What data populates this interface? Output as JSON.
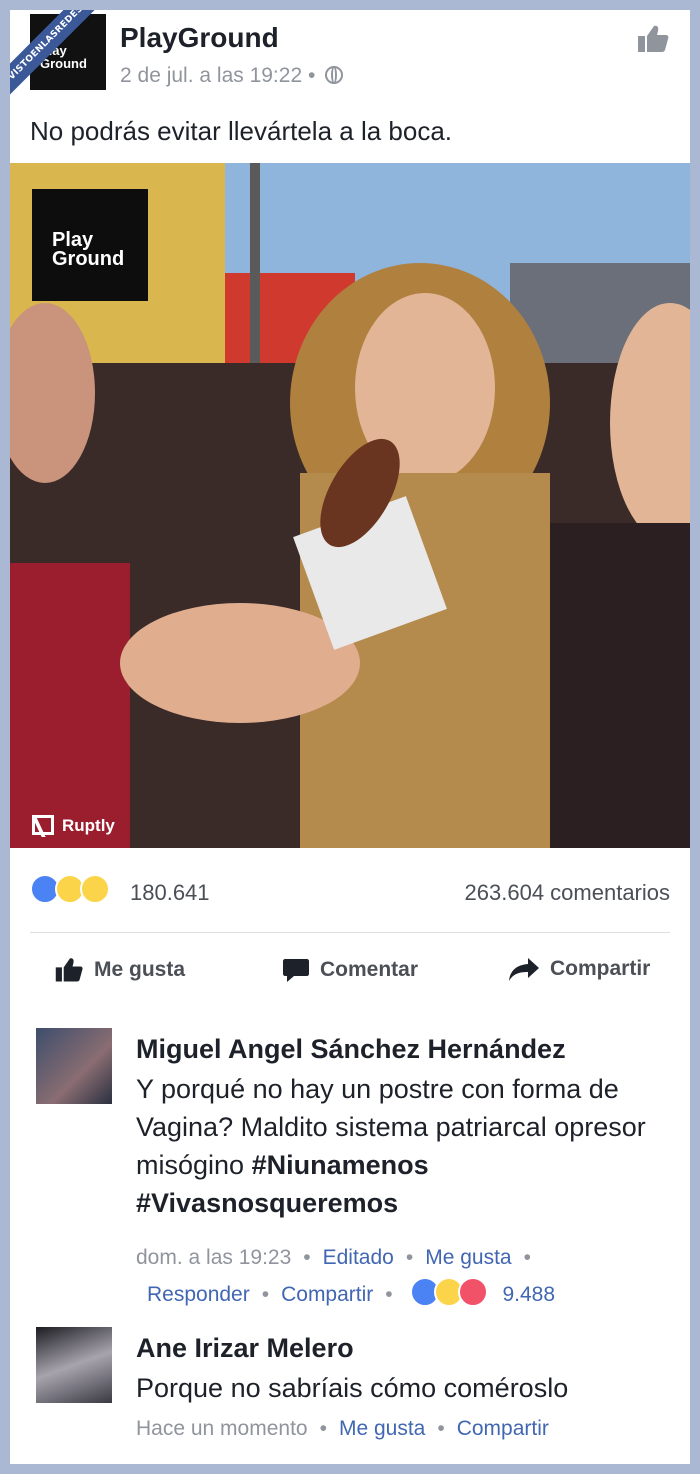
{
  "ribbon": "VISTOENLASREDES",
  "header": {
    "logo_text": "Play Ground",
    "page_name": "PlayGround",
    "post_time": "2 de jul. a las 19:22",
    "separator": "•"
  },
  "post": {
    "caption": "No podrás evitar llevártela a la boca.",
    "video_logo": "Play Ground",
    "video_source": "Ruptly"
  },
  "stats": {
    "reactions_count": "180.641",
    "comments_count": "263.604 comentarios"
  },
  "actions": {
    "like": "Me gusta",
    "comment": "Comentar",
    "share": "Compartir"
  },
  "comments": [
    {
      "author": "Miguel Angel Sánchez Hernández",
      "text_plain": "Y porqué no hay un postre con forma de Vagina? Maldito sistema patriarcal opresor misógino ",
      "hashtag1": "#Niunamenos",
      "hashtag2": "#Vivasnosqueremos",
      "time": "dom. a las 19:23",
      "edited": "Editado",
      "like": "Me gusta",
      "reply": "Responder",
      "share": "Compartir",
      "reactions": "9.488",
      "sep": "•"
    },
    {
      "author": "Ane Irizar Melero",
      "text_plain": "Porque no sabríais cómo coméroslo",
      "time": "Hace un momento",
      "like": "Me gusta",
      "share": "Compartir",
      "sep": "•"
    }
  ],
  "colors": {
    "accent": "#4267b2",
    "like_blue": "#4b83f4",
    "haha_yellow": "#fcd44a",
    "love_red": "#f25268",
    "frame_border": "#aab8d4"
  }
}
